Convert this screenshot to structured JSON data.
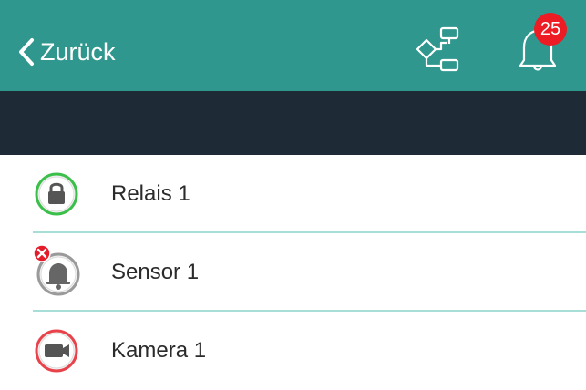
{
  "header": {
    "back_label": "Zurück",
    "notification_count": "25",
    "accent_color": "#2f978d",
    "subbar_color": "#1e2a35",
    "badge_color": "#ec1b24",
    "icons": [
      "chevron-left-icon",
      "diagram-icon",
      "bell-icon"
    ]
  },
  "devices": [
    {
      "label": "Relais 1",
      "icon": "lock-icon",
      "status_color": "#3cbf4a"
    },
    {
      "label": "Sensor 1",
      "icon": "bell-icon",
      "status_color": "#9a9a9a",
      "error_icon": "error-x-icon"
    },
    {
      "label": "Kamera 1",
      "icon": "camera-icon",
      "status_color": "#e8434a"
    }
  ]
}
